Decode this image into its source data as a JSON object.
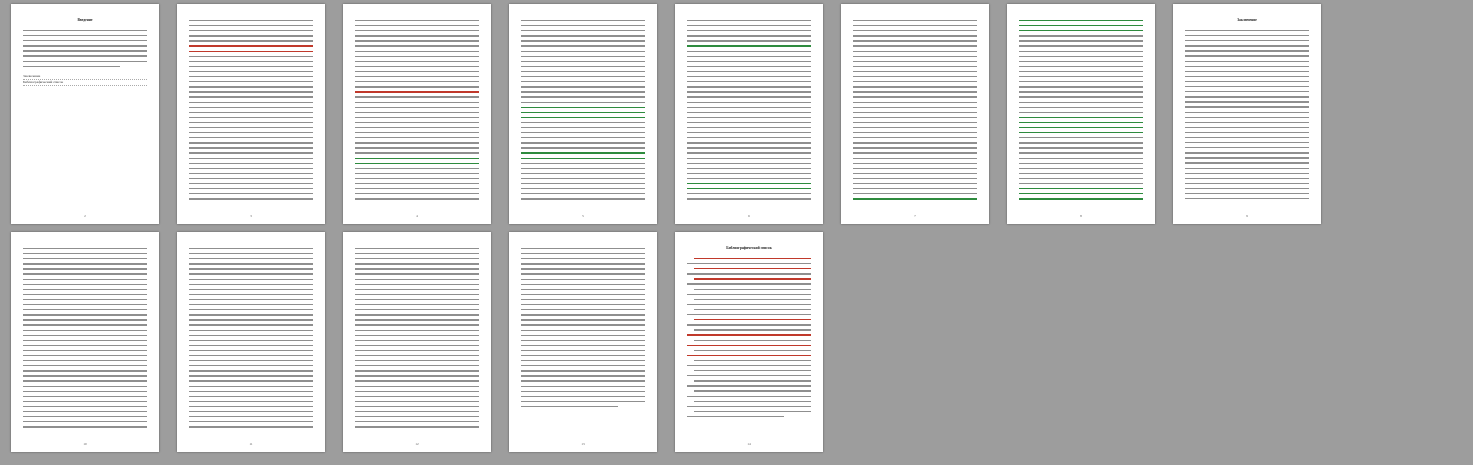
{
  "document": {
    "pages": [
      {
        "heading": "Введение",
        "number": "2"
      },
      {
        "heading": "",
        "number": "3"
      },
      {
        "heading": "",
        "number": "4"
      },
      {
        "heading": "",
        "number": "5"
      },
      {
        "heading": "",
        "number": "6"
      },
      {
        "heading": "",
        "number": "7"
      },
      {
        "heading": "",
        "number": "8"
      },
      {
        "heading": "Заключение",
        "number": "9"
      },
      {
        "heading": "",
        "number": "10"
      },
      {
        "heading": "",
        "number": "11"
      },
      {
        "heading": "",
        "number": "12"
      },
      {
        "heading": "",
        "number": "13"
      },
      {
        "heading": "Библиографический список",
        "number": "14"
      }
    ],
    "toc_entries": [
      "Заключение",
      "Библиографический список"
    ]
  }
}
